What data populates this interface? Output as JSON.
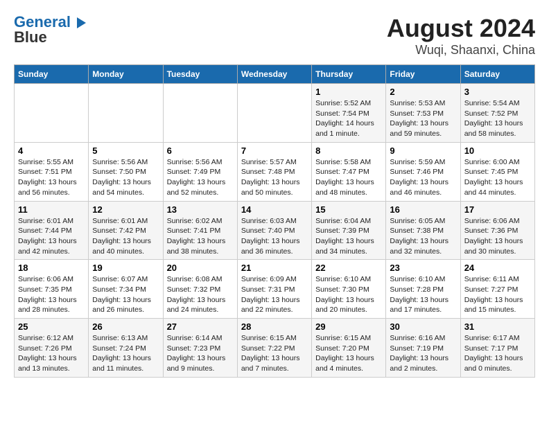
{
  "header": {
    "logo_line1": "General",
    "logo_line2": "Blue",
    "title": "August 2024",
    "subtitle": "Wuqi, Shaanxi, China"
  },
  "weekdays": [
    "Sunday",
    "Monday",
    "Tuesday",
    "Wednesday",
    "Thursday",
    "Friday",
    "Saturday"
  ],
  "weeks": [
    [
      {
        "day": "",
        "info": ""
      },
      {
        "day": "",
        "info": ""
      },
      {
        "day": "",
        "info": ""
      },
      {
        "day": "",
        "info": ""
      },
      {
        "day": "1",
        "info": "Sunrise: 5:52 AM\nSunset: 7:54 PM\nDaylight: 14 hours and 1 minute."
      },
      {
        "day": "2",
        "info": "Sunrise: 5:53 AM\nSunset: 7:53 PM\nDaylight: 13 hours and 59 minutes."
      },
      {
        "day": "3",
        "info": "Sunrise: 5:54 AM\nSunset: 7:52 PM\nDaylight: 13 hours and 58 minutes."
      }
    ],
    [
      {
        "day": "4",
        "info": "Sunrise: 5:55 AM\nSunset: 7:51 PM\nDaylight: 13 hours and 56 minutes."
      },
      {
        "day": "5",
        "info": "Sunrise: 5:56 AM\nSunset: 7:50 PM\nDaylight: 13 hours and 54 minutes."
      },
      {
        "day": "6",
        "info": "Sunrise: 5:56 AM\nSunset: 7:49 PM\nDaylight: 13 hours and 52 minutes."
      },
      {
        "day": "7",
        "info": "Sunrise: 5:57 AM\nSunset: 7:48 PM\nDaylight: 13 hours and 50 minutes."
      },
      {
        "day": "8",
        "info": "Sunrise: 5:58 AM\nSunset: 7:47 PM\nDaylight: 13 hours and 48 minutes."
      },
      {
        "day": "9",
        "info": "Sunrise: 5:59 AM\nSunset: 7:46 PM\nDaylight: 13 hours and 46 minutes."
      },
      {
        "day": "10",
        "info": "Sunrise: 6:00 AM\nSunset: 7:45 PM\nDaylight: 13 hours and 44 minutes."
      }
    ],
    [
      {
        "day": "11",
        "info": "Sunrise: 6:01 AM\nSunset: 7:44 PM\nDaylight: 13 hours and 42 minutes."
      },
      {
        "day": "12",
        "info": "Sunrise: 6:01 AM\nSunset: 7:42 PM\nDaylight: 13 hours and 40 minutes."
      },
      {
        "day": "13",
        "info": "Sunrise: 6:02 AM\nSunset: 7:41 PM\nDaylight: 13 hours and 38 minutes."
      },
      {
        "day": "14",
        "info": "Sunrise: 6:03 AM\nSunset: 7:40 PM\nDaylight: 13 hours and 36 minutes."
      },
      {
        "day": "15",
        "info": "Sunrise: 6:04 AM\nSunset: 7:39 PM\nDaylight: 13 hours and 34 minutes."
      },
      {
        "day": "16",
        "info": "Sunrise: 6:05 AM\nSunset: 7:38 PM\nDaylight: 13 hours and 32 minutes."
      },
      {
        "day": "17",
        "info": "Sunrise: 6:06 AM\nSunset: 7:36 PM\nDaylight: 13 hours and 30 minutes."
      }
    ],
    [
      {
        "day": "18",
        "info": "Sunrise: 6:06 AM\nSunset: 7:35 PM\nDaylight: 13 hours and 28 minutes."
      },
      {
        "day": "19",
        "info": "Sunrise: 6:07 AM\nSunset: 7:34 PM\nDaylight: 13 hours and 26 minutes."
      },
      {
        "day": "20",
        "info": "Sunrise: 6:08 AM\nSunset: 7:32 PM\nDaylight: 13 hours and 24 minutes."
      },
      {
        "day": "21",
        "info": "Sunrise: 6:09 AM\nSunset: 7:31 PM\nDaylight: 13 hours and 22 minutes."
      },
      {
        "day": "22",
        "info": "Sunrise: 6:10 AM\nSunset: 7:30 PM\nDaylight: 13 hours and 20 minutes."
      },
      {
        "day": "23",
        "info": "Sunrise: 6:10 AM\nSunset: 7:28 PM\nDaylight: 13 hours and 17 minutes."
      },
      {
        "day": "24",
        "info": "Sunrise: 6:11 AM\nSunset: 7:27 PM\nDaylight: 13 hours and 15 minutes."
      }
    ],
    [
      {
        "day": "25",
        "info": "Sunrise: 6:12 AM\nSunset: 7:26 PM\nDaylight: 13 hours and 13 minutes."
      },
      {
        "day": "26",
        "info": "Sunrise: 6:13 AM\nSunset: 7:24 PM\nDaylight: 13 hours and 11 minutes."
      },
      {
        "day": "27",
        "info": "Sunrise: 6:14 AM\nSunset: 7:23 PM\nDaylight: 13 hours and 9 minutes."
      },
      {
        "day": "28",
        "info": "Sunrise: 6:15 AM\nSunset: 7:22 PM\nDaylight: 13 hours and 7 minutes."
      },
      {
        "day": "29",
        "info": "Sunrise: 6:15 AM\nSunset: 7:20 PM\nDaylight: 13 hours and 4 minutes."
      },
      {
        "day": "30",
        "info": "Sunrise: 6:16 AM\nSunset: 7:19 PM\nDaylight: 13 hours and 2 minutes."
      },
      {
        "day": "31",
        "info": "Sunrise: 6:17 AM\nSunset: 7:17 PM\nDaylight: 13 hours and 0 minutes."
      }
    ]
  ]
}
